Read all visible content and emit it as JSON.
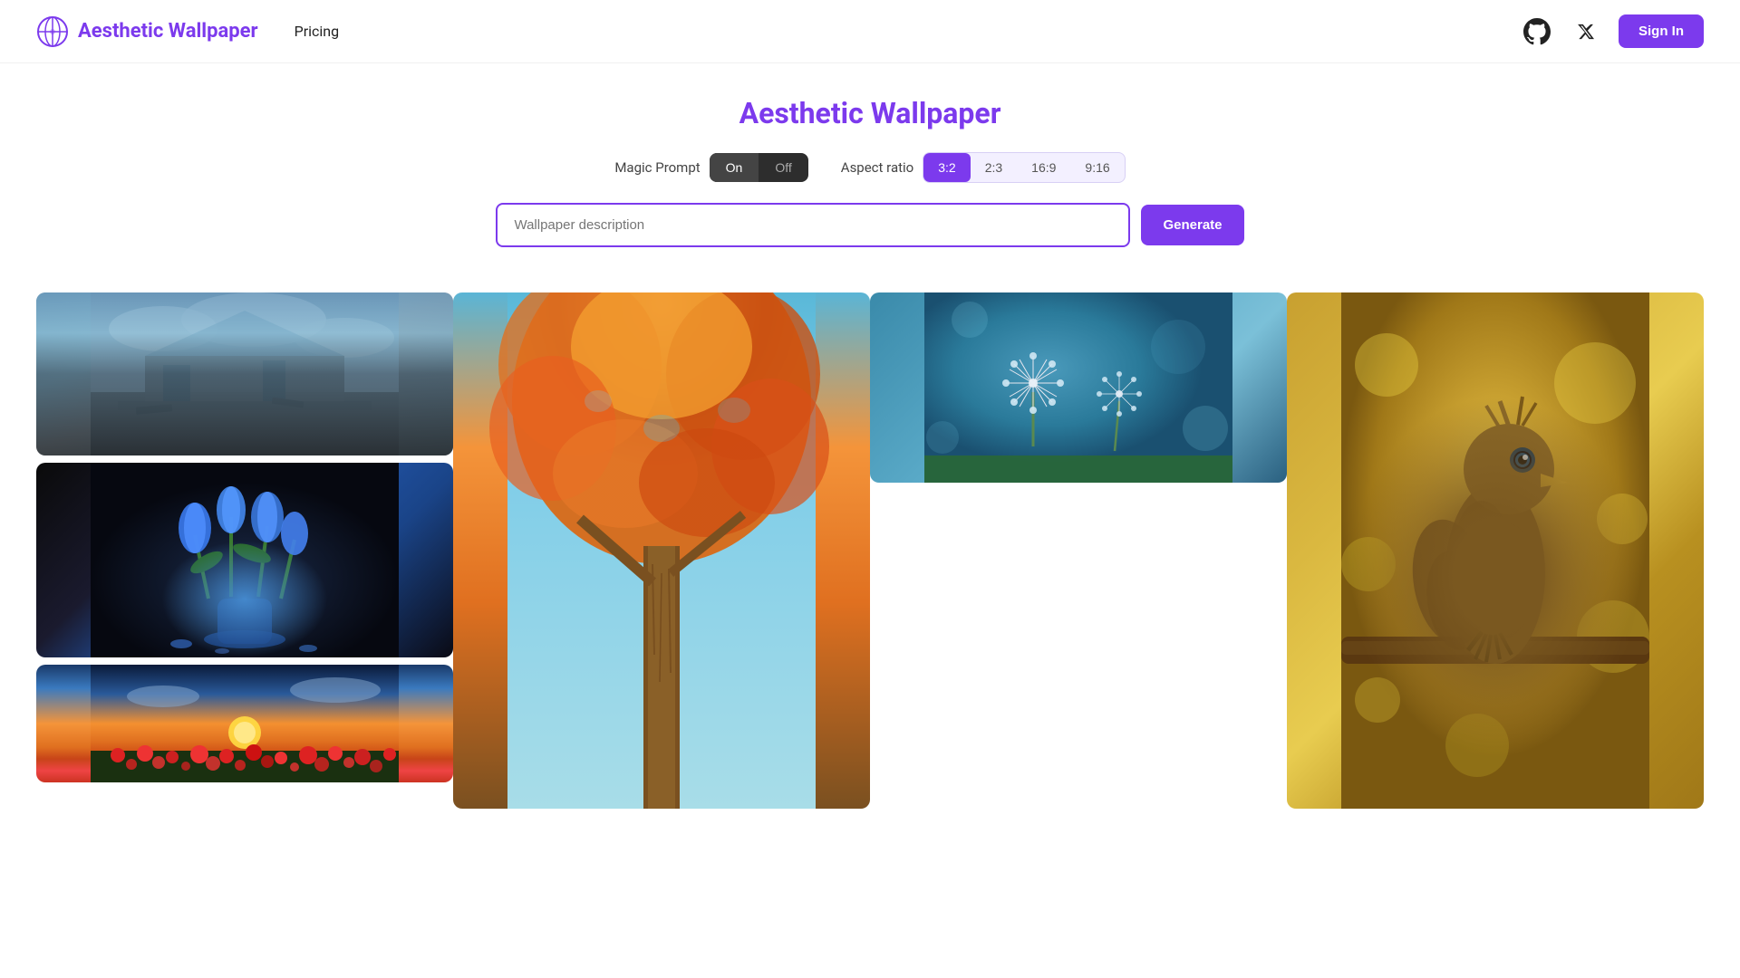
{
  "nav": {
    "brand": {
      "title": "Aesthetic Wallpaper",
      "logo_alt": "globe-icon"
    },
    "links": [
      {
        "label": "Pricing",
        "id": "pricing"
      }
    ],
    "github_label": "github-icon",
    "x_label": "x-icon",
    "sign_in": "Sign In"
  },
  "hero": {
    "title": "Aesthetic Wallpaper",
    "magic_prompt_label": "Magic Prompt",
    "toggle_on": "On",
    "toggle_off": "Off",
    "aspect_ratio_label": "Aspect ratio",
    "aspect_options": [
      "3:2",
      "2:3",
      "16:9",
      "9:16"
    ],
    "active_aspect": "3:2",
    "search_placeholder": "Wallpaper description",
    "generate_label": "Generate"
  },
  "gallery": {
    "images": [
      {
        "id": "destroyed-house",
        "alt": "Destroyed house with dramatic sky"
      },
      {
        "id": "autumn-tree",
        "alt": "Autumn tree looking up"
      },
      {
        "id": "dandelion",
        "alt": "Dandelion with water droplets"
      },
      {
        "id": "tulips",
        "alt": "Blue tulips in glass vase"
      },
      {
        "id": "sunset-poppies",
        "alt": "Sunset over poppy field"
      },
      {
        "id": "bird",
        "alt": "Detailed bird on branch with golden bokeh"
      }
    ]
  }
}
